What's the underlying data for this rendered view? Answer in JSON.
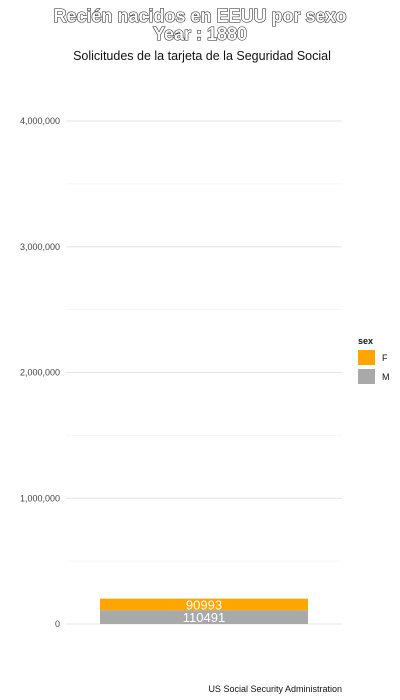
{
  "chart_data": {
    "type": "bar",
    "stacked": true,
    "title": "Recién nacidos en EEUU por sexo",
    "title_line2": "Year : 1880",
    "subtitle": "Solicitudes de la tarjeta de la Seguridad Social",
    "caption": "US Social Security Administration",
    "xlabel": "",
    "ylabel": "",
    "ylim": [
      0,
      4000000
    ],
    "y_ticks": [
      0,
      1000000,
      2000000,
      3000000,
      4000000
    ],
    "y_tick_labels": [
      "0",
      "1,000,000",
      "2,000,000",
      "3,000,000",
      "4,000,000"
    ],
    "grid": true,
    "legend": {
      "title": "sex",
      "position": "right"
    },
    "categories": [
      "1880"
    ],
    "series": [
      {
        "name": "F",
        "values": [
          90993
        ],
        "color": "#FFA500",
        "label": "90993"
      },
      {
        "name": "M",
        "values": [
          110491
        ],
        "color": "#A9A9A9",
        "label": "110491"
      }
    ]
  }
}
